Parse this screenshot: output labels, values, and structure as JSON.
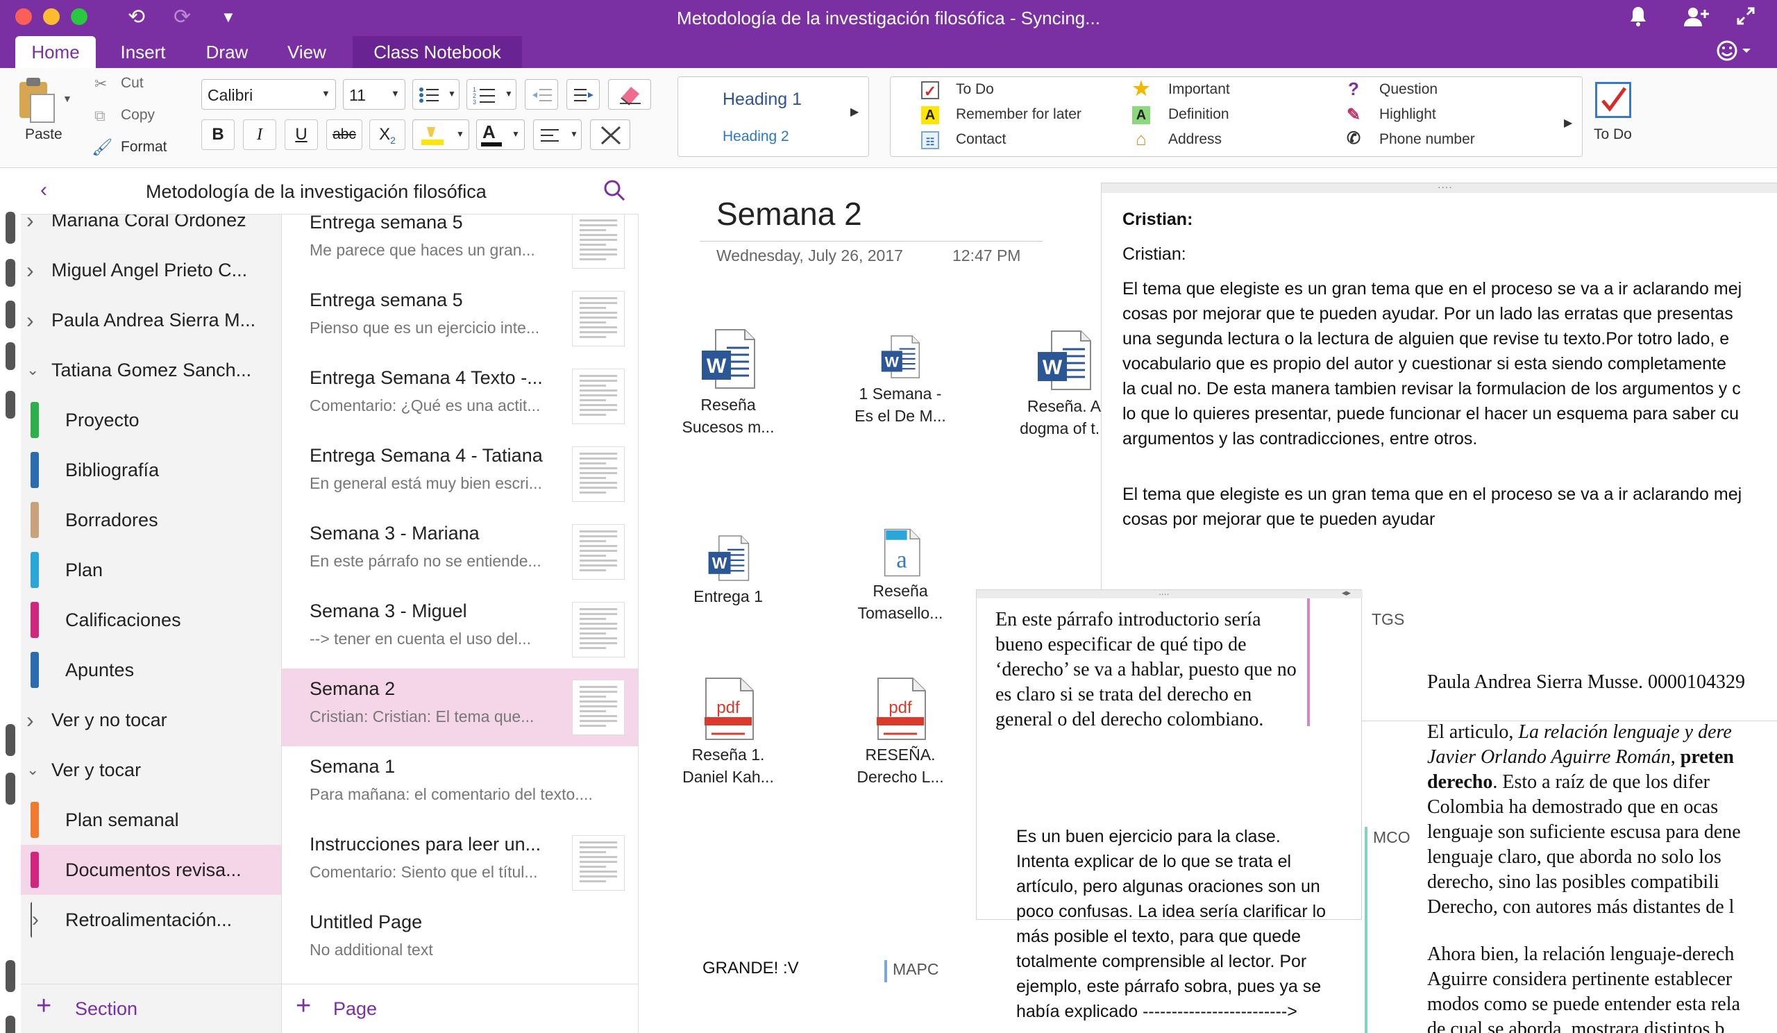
{
  "window": {
    "title": "Metodología de la investigación filosófica - Syncing..."
  },
  "tabs": [
    "Home",
    "Insert",
    "Draw",
    "View",
    "Class Notebook"
  ],
  "ribbon": {
    "paste": "Paste",
    "cut": "Cut",
    "copy": "Copy",
    "format": "Format",
    "font": "Calibri",
    "size": "11",
    "bold": "B",
    "italic": "I",
    "underline": "U",
    "strike": "abc",
    "sub": "X",
    "styles": [
      "Heading 1",
      "Heading 2"
    ],
    "tags": [
      {
        "label": "To Do",
        "icon": "checkbox-icon"
      },
      {
        "label": "Important",
        "icon": "star-icon"
      },
      {
        "label": "Question",
        "icon": "question-icon"
      },
      {
        "label": "Remember for later",
        "icon": "highlight-a-icon"
      },
      {
        "label": "Definition",
        "icon": "definition-a-icon"
      },
      {
        "label": "Highlight",
        "icon": "pen-icon"
      },
      {
        "label": "Contact",
        "icon": "contact-card-icon"
      },
      {
        "label": "Address",
        "icon": "house-icon"
      },
      {
        "label": "Phone number",
        "icon": "phone-icon"
      }
    ],
    "todo_button": "To Do"
  },
  "nav": {
    "notebook": "Metodología de la investigación filosófica",
    "sections": [
      {
        "label": "Mariana Coral Ordonez",
        "type": "group",
        "expanded": false
      },
      {
        "label": "Miguel Angel Prieto C...",
        "type": "group",
        "expanded": false
      },
      {
        "label": "Paula Andrea Sierra M...",
        "type": "group",
        "expanded": false
      },
      {
        "label": "Tatiana Gomez Sanch...",
        "type": "group",
        "expanded": true
      },
      {
        "label": "Proyecto",
        "type": "section",
        "color": "#2fae4e"
      },
      {
        "label": "Bibliografía",
        "type": "section",
        "color": "#2b6cb0"
      },
      {
        "label": "Borradores",
        "type": "section",
        "color": "#c8a27a"
      },
      {
        "label": "Plan",
        "type": "section",
        "color": "#2aa7d8"
      },
      {
        "label": "Calificaciones",
        "type": "section",
        "color": "#d0267c"
      },
      {
        "label": "Apuntes",
        "type": "section",
        "color": "#2b6cb0"
      },
      {
        "label": "Ver y no tocar",
        "type": "group",
        "expanded": false
      },
      {
        "label": "Ver y tocar",
        "type": "group",
        "expanded": true
      },
      {
        "label": "Plan semanal",
        "type": "section",
        "color": "#f07a2e"
      },
      {
        "label": "Documentos revisa...",
        "type": "section",
        "color": "#d0267c",
        "selected": true
      },
      {
        "label": "Retroalimentación...",
        "type": "section",
        "color": "#555555"
      }
    ],
    "add_section": "Section",
    "pages": [
      {
        "title": "Entrega semana 5",
        "sub": "Me parece que haces un gran..."
      },
      {
        "title": "Entrega semana 5",
        "sub": "Pienso que es un ejercicio inte..."
      },
      {
        "title": "Entrega Semana 4 Texto -...",
        "sub": "Comentario: ¿Qué es una actit..."
      },
      {
        "title": "Entrega Semana 4 - Tatiana",
        "sub": "En general está muy bien escri..."
      },
      {
        "title": "Semana 3 - Mariana",
        "sub": "En este párrafo no se entiende..."
      },
      {
        "title": "Semana 3 - Miguel",
        "sub": "--> tener en cuenta el uso del..."
      },
      {
        "title": "Semana 2",
        "sub": "Cristian:  Cristian:  El tema que...",
        "selected": true
      },
      {
        "title": "Semana 1",
        "sub": "Para mañana: el comentario del texto...."
      },
      {
        "title": "Instrucciones para leer un...",
        "sub": "Comentario: Siento que el títul..."
      },
      {
        "title": "Untitled Page",
        "sub": "No additional text"
      }
    ],
    "add_page": "Page"
  },
  "page": {
    "title": "Semana 2",
    "date": "Wednesday, July 26, 2017",
    "time": "12:47 PM",
    "files": [
      {
        "name": "Reseña\nSucesos m...",
        "type": "word"
      },
      {
        "name": "1 Semana -\nEs el De M...",
        "type": "word"
      },
      {
        "name": "Reseña. A\ndogma of t...",
        "type": "word"
      },
      {
        "name": "Entrega 1",
        "type": "word"
      },
      {
        "name": "Reseña\nTomasello...",
        "type": "text"
      },
      {
        "name": "Reseña 1.\nDaniel Kah...",
        "type": "pdf"
      },
      {
        "name": "RESEÑA.\nDerecho L...",
        "type": "pdf"
      }
    ],
    "comment_box": {
      "line1": "Cristian:",
      "line2": "Cristian:",
      "para1": [
        "El tema que elegiste es un gran tema que en el proceso se va a ir aclarando mej",
        "cosas por mejorar que te pueden ayudar. Por un lado las erratas que presentas",
        "una segunda lectura o la lectura de alguien que revise tu texto.Por totro lado, e",
        "vocabulario que es propio del autor y cuestionar si esta siendo completamente",
        "la cual no. De esta manera tambien revisar la formulacion de los argumentos y c",
        "lo que lo quieres presentar, puede funcionar el hacer un esquema para saber cu",
        "argumentos y las contradicciones, entre otros."
      ],
      "para2": [
        "El tema que elegiste es un gran tema que en el proceso se va a ir aclarando mej",
        "cosas por mejorar que te pueden ayudar"
      ]
    },
    "tgs_note": [
      "En este párrafo introductorio sería",
      "bueno especificar de qué tipo de",
      "‘derecho’ se va a hablar, puesto que no",
      "es claro si se trata del derecho en",
      "general o del derecho colombiano."
    ],
    "tgs_label": "TGS",
    "mco_note": [
      "Es un buen ejercicio para la clase.",
      "Intenta explicar de lo que se trata el",
      "artículo, pero algunas oraciones son un",
      "poco confusas. La idea sería clarificar lo",
      "más posible el texto, para que quede",
      "totalmente comprensible al lector. Por",
      "ejemplo, este párrafo sobra, pues ya se",
      "había explicado ------------------------->"
    ],
    "mco_label": "MCO",
    "grande": "GRANDE! :V",
    "mapc_label": "MAPC",
    "doc_author": "Paula Andrea Sierra Musse. 0000104329",
    "doc_para1": {
      "l1a": "El articulo, ",
      "l1b": "La relación lenguaje y dere",
      "l2a": "Javier Orlando Aguirre Román",
      "l2b": ", ",
      "l2c": "preten",
      "l3a": "derecho",
      "l3b": ". Esto a raíz de que los difer",
      "l4": "Colombia ha demostrado que en ocas",
      "l5": "lenguaje son suficiente escusa para dene",
      "l6": "lenguaje claro, que aborda no solo los",
      "l7": "derecho, sino las posibles compatibili",
      "l8": "Derecho, con  autores más distantes de l"
    },
    "doc_para2": [
      "Ahora bien, la relación  lenguaje-derech",
      "Aguirre considera pertinente establecer",
      "modos como se puede entender esta rela",
      "de cual se aborda, mostrara distintos b"
    ]
  }
}
